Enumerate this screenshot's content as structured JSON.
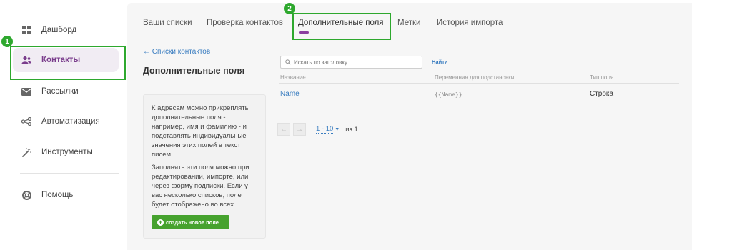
{
  "sidebar": {
    "items": [
      {
        "label": "Дашборд",
        "icon": "grid-icon"
      },
      {
        "label": "Контакты",
        "icon": "users-icon"
      },
      {
        "label": "Рассылки",
        "icon": "mail-icon"
      },
      {
        "label": "Автоматизация",
        "icon": "share-icon"
      },
      {
        "label": "Инструменты",
        "icon": "magic-wand-icon"
      },
      {
        "label": "Помощь",
        "icon": "lifebuoy-icon"
      }
    ]
  },
  "badges": {
    "step1": "1",
    "step2": "2"
  },
  "tabs": [
    {
      "label": "Ваши списки"
    },
    {
      "label": "Проверка контактов"
    },
    {
      "label": "Дополнительные поля"
    },
    {
      "label": "Метки"
    },
    {
      "label": "История импорта"
    }
  ],
  "back_link": "← Списки контактов",
  "page_title": "Дополнительные поля",
  "info": {
    "paragraph1": "К адресам можно прикреплять дополнительные поля - например, имя и фамилию - и подставлять индивидуальные значения этих полей в текст писем.",
    "paragraph2": "Заполнять эти поля можно при редактировании, импорте, или через форму подписки. Если у вас несколько списков, поле будет отображено во всех.",
    "create_button": "создать новое поле"
  },
  "search": {
    "placeholder": "Искать по заголовку",
    "button": "Найти"
  },
  "table": {
    "headers": [
      "Название",
      "Переменная для подстановки",
      "Тип поля"
    ],
    "rows": [
      {
        "name": "Name",
        "variable": "{{Name}}",
        "type": "Строка"
      }
    ]
  },
  "pager": {
    "prev": "←",
    "next": "→",
    "range": "1 - 10",
    "of": "из 1"
  },
  "colors": {
    "accent": "#8b3fa0",
    "highlight": "#2ea82e",
    "link": "#3a7dc0",
    "button": "#46a22e"
  }
}
